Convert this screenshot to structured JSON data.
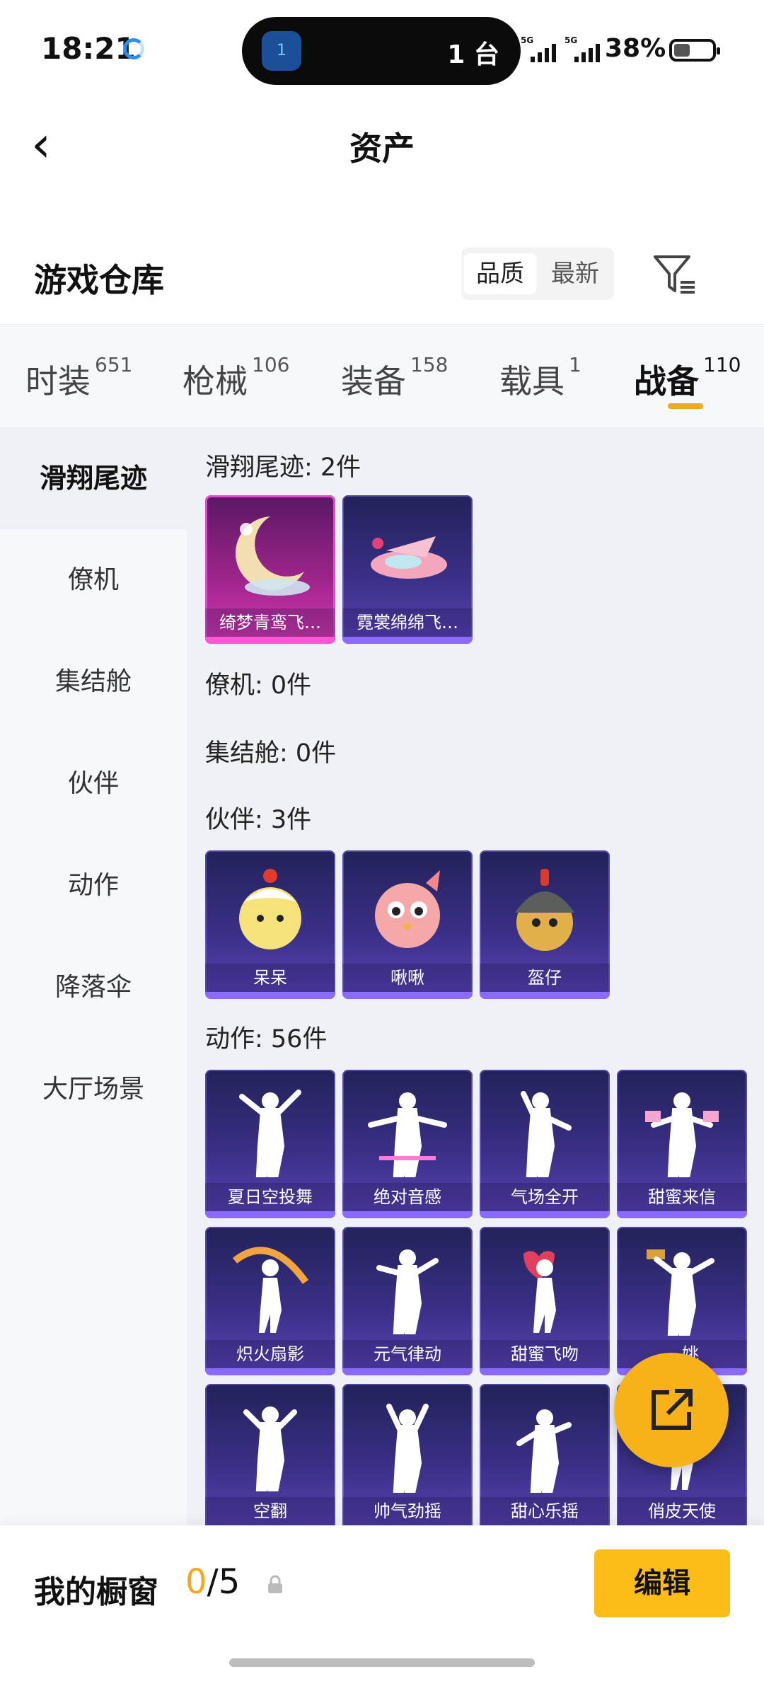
{
  "status_bar": {
    "time": "18:21",
    "island_count": "1 台",
    "battery": "38%",
    "signal_tag": "5G",
    "island_badge": "1"
  },
  "header": {
    "title": "资产"
  },
  "warehouse": {
    "title": "游戏仓库",
    "sort_quality": "品质",
    "sort_latest": "最新"
  },
  "tabs": [
    {
      "label": "时装",
      "count": "651"
    },
    {
      "label": "枪械",
      "count": "106"
    },
    {
      "label": "装备",
      "count": "158"
    },
    {
      "label": "载具",
      "count": "1"
    },
    {
      "label": "战备",
      "count": "110"
    }
  ],
  "sidebar": [
    "滑翔尾迹",
    "僚机",
    "集结舱",
    "伙伴",
    "动作",
    "降落伞",
    "大厅场景"
  ],
  "sections": {
    "glide": {
      "title": "滑翔尾迹: 2件",
      "items": [
        "绮梦青鸾飞…",
        "霓裳绵绵飞…"
      ]
    },
    "wingman": {
      "title": "僚机: 0件"
    },
    "capsule": {
      "title": "集结舱: 0件"
    },
    "partner": {
      "title": "伙伴: 3件",
      "items": [
        "呆呆",
        "啾啾",
        "盔仔"
      ]
    },
    "emote": {
      "title": "动作: 56件",
      "items": [
        "夏日空投舞",
        "绝对音感",
        "气场全开",
        "甜蜜来信",
        "炽火扇影",
        "元气律动",
        "甜蜜飞吻",
        "…姚",
        "空翻",
        "帅气劲摇",
        "甜心乐摇",
        "俏皮天使"
      ]
    }
  },
  "bottom": {
    "label": "我的橱窗",
    "count_current": "0",
    "count_total": "/5",
    "edit": "编辑"
  },
  "colors": {
    "accent": "#f5a623",
    "button": "#fbbd16",
    "card_purple": "#3a2f86",
    "card_pink": "#a3268e"
  }
}
